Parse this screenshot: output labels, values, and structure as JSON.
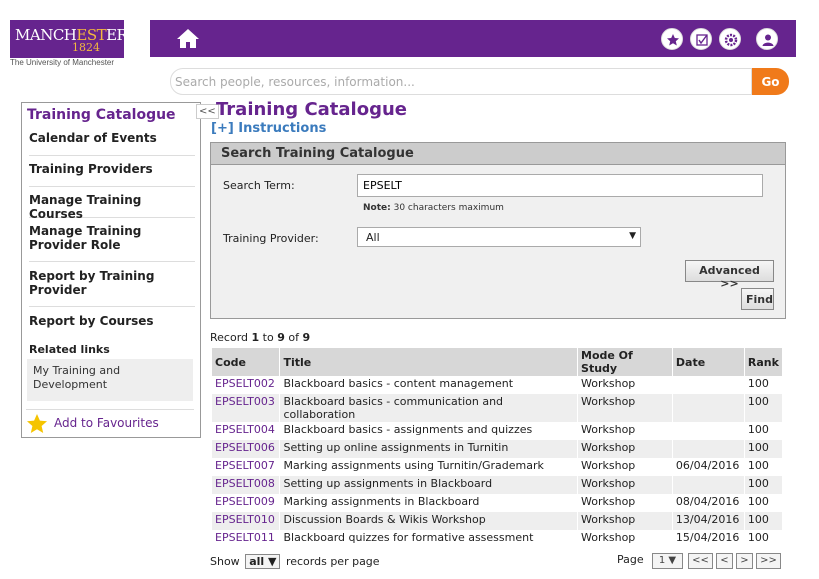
{
  "logo": {
    "name_pre": "MANCH",
    "name_hl": "EST",
    "name_post": "ER",
    "year": "1824",
    "subtitle": "The University of Manchester"
  },
  "search": {
    "placeholder": "Search people, resources, information...",
    "go_label": "Go"
  },
  "header_icons": [
    "home-icon",
    "star-icon",
    "checkbox-icon",
    "gear-icon",
    "user-icon"
  ],
  "sidebar": {
    "title": "Training Catalogue",
    "collapse_label": "<<",
    "items": [
      {
        "label": "Calendar of Events"
      },
      {
        "label": "Training Providers"
      },
      {
        "label": "Manage Training Courses"
      },
      {
        "label": "Manage Training Provider Role"
      },
      {
        "label": "Report by Training Provider"
      },
      {
        "label": "Report by Courses"
      }
    ],
    "related_title": "Related links",
    "related_link": "My Training and Development",
    "favourites_label": "Add to Favourites"
  },
  "main": {
    "title": "Training Catalogue",
    "instructions": "[+] Instructions",
    "panel_title": "Search Training Catalogue",
    "search_term_label": "Search Term:",
    "search_term_value": "EPSELT",
    "note_label": "Note:",
    "note_text": "30 characters maximum",
    "provider_label": "Training Provider:",
    "provider_value": "All",
    "advanced_label": "Advanced >>",
    "find_label": "Find"
  },
  "results": {
    "record_prefix": "Record",
    "record_from": "1",
    "record_to_word": "to",
    "record_to": "9",
    "record_of_word": "of",
    "record_total": "9",
    "columns": [
      "Code",
      "Title",
      "Mode Of Study",
      "Date",
      "Rank"
    ],
    "rows": [
      {
        "code": "EPSELT002",
        "title": "Blackboard basics - content management",
        "mode": "Workshop",
        "date": "",
        "rank": "100"
      },
      {
        "code": "EPSELT003",
        "title": "Blackboard basics - communication and collaboration",
        "mode": "Workshop",
        "date": "",
        "rank": "100"
      },
      {
        "code": "EPSELT004",
        "title": "Blackboard basics - assignments and quizzes",
        "mode": "Workshop",
        "date": "",
        "rank": "100"
      },
      {
        "code": "EPSELT006",
        "title": "Setting up online assignments in Turnitin",
        "mode": "Workshop",
        "date": "",
        "rank": "100"
      },
      {
        "code": "EPSELT007",
        "title": "Marking assignments using Turnitin/Grademark",
        "mode": "Workshop",
        "date": "06/04/2016",
        "rank": "100"
      },
      {
        "code": "EPSELT008",
        "title": "Setting up assignments in Blackboard",
        "mode": "Workshop",
        "date": "",
        "rank": "100"
      },
      {
        "code": "EPSELT009",
        "title": "Marking assignments in Blackboard",
        "mode": "Workshop",
        "date": "08/04/2016",
        "rank": "100"
      },
      {
        "code": "EPSELT010",
        "title": "Discussion Boards & Wikis Workshop",
        "mode": "Workshop",
        "date": "13/04/2016",
        "rank": "100"
      },
      {
        "code": "EPSELT011",
        "title": "Blackboard quizzes for formative assessment",
        "mode": "Workshop",
        "date": "15/04/2016",
        "rank": "100"
      }
    ]
  },
  "footer": {
    "show_label": "Show",
    "show_value": "all",
    "per_page_label": "records per page",
    "page_label": "Page",
    "page_value": "1",
    "first": "<<",
    "prev": "<",
    "next": ">",
    "last": ">>"
  },
  "colors": {
    "brand_purple": "#66248e",
    "go_orange": "#f07a1a",
    "link_blue": "#3b7bbd"
  }
}
